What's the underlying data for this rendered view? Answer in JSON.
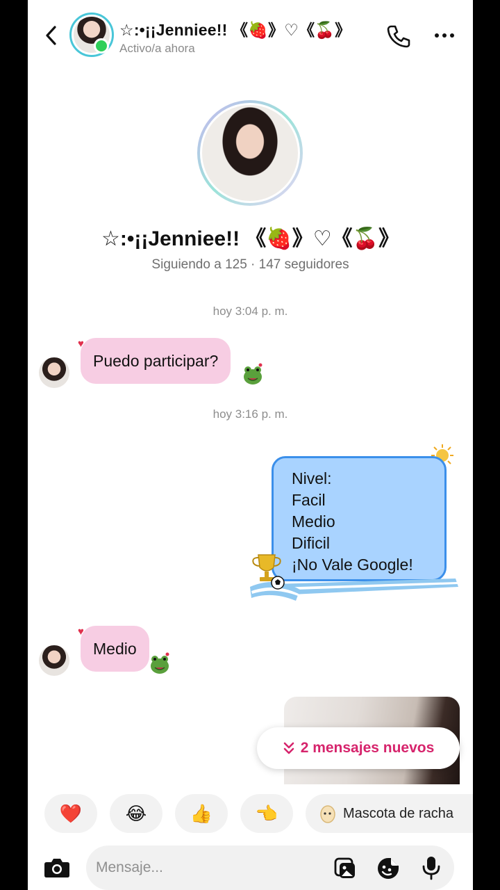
{
  "header": {
    "name": "☆:•¡¡Jenniee!! 《🍓》♡《🍒》",
    "status": "Activo/a ahora"
  },
  "profile": {
    "name": "☆:•¡¡Jenniee!! 《🍓》♡《🍒》",
    "stats": "Siguiendo a 125 · 147 seguidores"
  },
  "messages": {
    "ts1": "hoy 3:04 p. m.",
    "msg1": "Puedo participar?",
    "ts2": "hoy 3:16 p. m.",
    "out_lines": [
      "Nivel:",
      "Facil",
      "Medio",
      "Dificil",
      "¡No Vale Google!"
    ],
    "msg2": "Medio"
  },
  "new_messages": {
    "label": "2 mensajes nuevos"
  },
  "quick_reactions": {
    "heart": "❤️",
    "laugh": "😂",
    "thumbs": "👍",
    "point": "👈",
    "streak_label": "Mascota de racha"
  },
  "composer": {
    "placeholder": "Mensaje..."
  },
  "colors": {
    "incoming_bubble": "#f7cde3",
    "outgoing_bubble": "#a9d3ff",
    "outgoing_border": "#3b8fea",
    "accent_pink": "#d6246c",
    "online": "#2fcf5a"
  }
}
